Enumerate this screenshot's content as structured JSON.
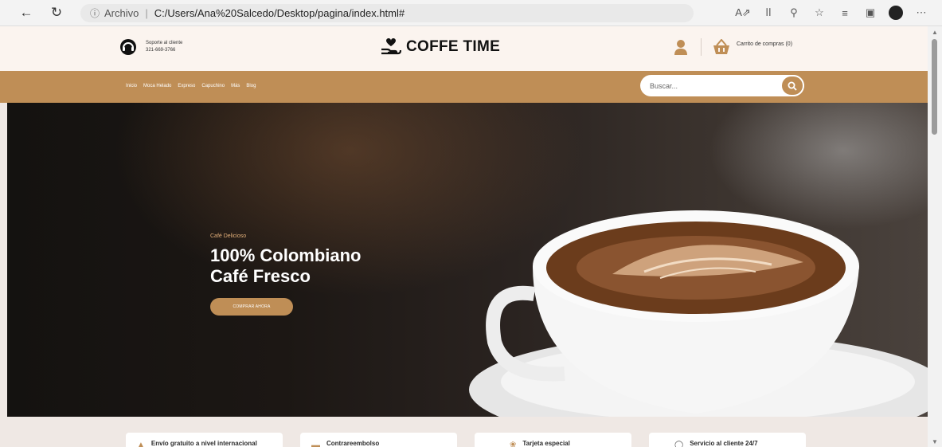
{
  "browser": {
    "address_label": "Archivo",
    "url": "C:/Users/Ana%20Salcedo/Desktop/pagina/index.html#"
  },
  "header": {
    "support_label": "Soporte al cliente",
    "support_phone": "321-669-3766",
    "logo_text": "COFFE TIME",
    "cart_label": "Carrito de compras (0)"
  },
  "nav": {
    "items": [
      "Inicio",
      "Moca Helado",
      "Expreso",
      "Capuchino",
      "Más",
      "Blog"
    ],
    "search_placeholder": "Buscar..."
  },
  "hero": {
    "kicker": "Café Delicioso",
    "title_line1": "100% Colombiano",
    "title_line2": "Café Fresco",
    "cta_label": "COMPRAR AHORA"
  },
  "features": [
    {
      "label": "Envío gratuito a nivel internacional"
    },
    {
      "label": "Contrareembolso"
    },
    {
      "label": "Tarjeta especial"
    },
    {
      "label": "Servicio al cliente 24/7"
    }
  ],
  "colors": {
    "accent": "#bf8e56",
    "header_bg": "#fbf4ef",
    "page_bg": "#efe8e4"
  },
  "icons": {
    "back": "back-arrow-icon",
    "refresh": "refresh-icon",
    "support": "headset-icon",
    "logo": "coffee-hand-heart-icon",
    "user": "user-icon",
    "cart": "basket-icon",
    "search": "search-icon"
  }
}
